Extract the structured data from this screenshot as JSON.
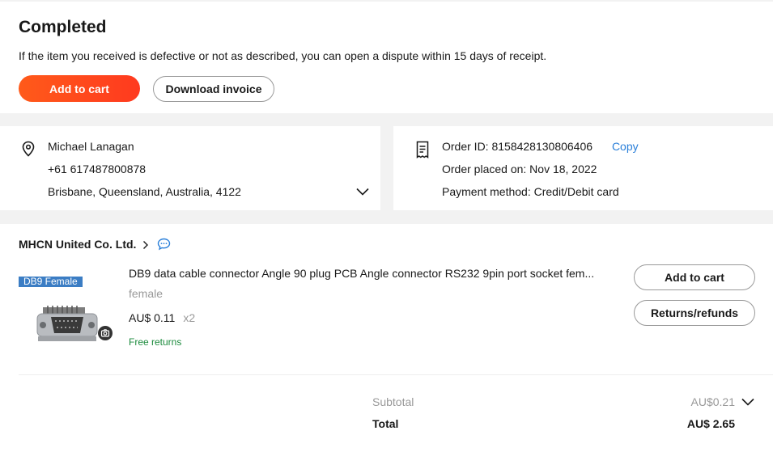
{
  "status": {
    "title": "Completed",
    "description": "If the item you received is defective or not as described, you can open a dispute within 15 days of receipt.",
    "add_to_cart_label": "Add to cart",
    "download_invoice_label": "Download invoice"
  },
  "address": {
    "icon": "location-pin-icon",
    "name": "Michael Lanagan",
    "phone": "+61 617487800878",
    "location": "Brisbane, Queensland, Australia, 4122",
    "expand_icon": "chevron-down-icon"
  },
  "order": {
    "icon": "receipt-icon",
    "order_id": "Order ID: 8158428130806406",
    "copy_label": "Copy",
    "placed_on": "Order placed on: Nov 18, 2022",
    "payment_method": "Payment method: Credit/Debit card"
  },
  "store": {
    "name": "MHCN United Co. Ltd.",
    "chevron_icon": "chevron-right-icon",
    "chat_icon": "chat-bubble-icon",
    "product": {
      "image_tag": "DB9 Female",
      "title": "DB9 data cable connector Angle 90 plug PCB Angle connector RS232 9pin port socket fem...",
      "variant": "female",
      "price": "AU$ 0.11",
      "quantity": "x2",
      "free_returns": "Free returns",
      "camera_icon": "camera-icon",
      "add_to_cart_label": "Add to cart",
      "returns_label": "Returns/refunds"
    },
    "summary": {
      "subtotal_label": "Subtotal",
      "subtotal_value": "AU$0.21",
      "total_label": "Total",
      "total_value": "AU$ 2.65"
    }
  },
  "colors": {
    "primary_button": "#ff4a1c",
    "link": "#2a7fd9",
    "free_returns": "#1b8a3c",
    "muted": "#999999",
    "image_tag": "#3b7dc4"
  }
}
